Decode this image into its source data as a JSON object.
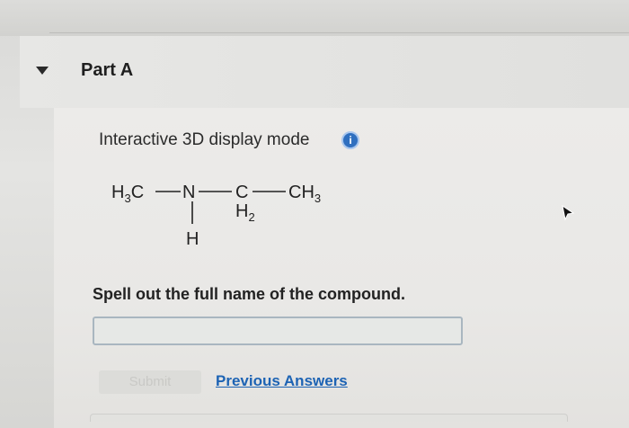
{
  "section": {
    "title": "Part A"
  },
  "display": {
    "mode_label": "Interactive 3D display mode",
    "info_glyph": "i"
  },
  "molecule": {
    "atoms": {
      "h3c": {
        "main": "H",
        "sub": "3",
        "tail": "C"
      },
      "n": "N",
      "c": "C",
      "c_h": {
        "main": "H",
        "sub": "2"
      },
      "ch3": {
        "main": "CH",
        "sub": "3"
      },
      "n_h": "H"
    }
  },
  "question": {
    "text": "Spell out the full name of the compound."
  },
  "answer": {
    "value": "",
    "placeholder": ""
  },
  "actions": {
    "submit_label": "Submit",
    "previous_answers_label": "Previous Answers"
  },
  "colors": {
    "accent": "#1d63b4",
    "info": "#2f6fbf"
  }
}
